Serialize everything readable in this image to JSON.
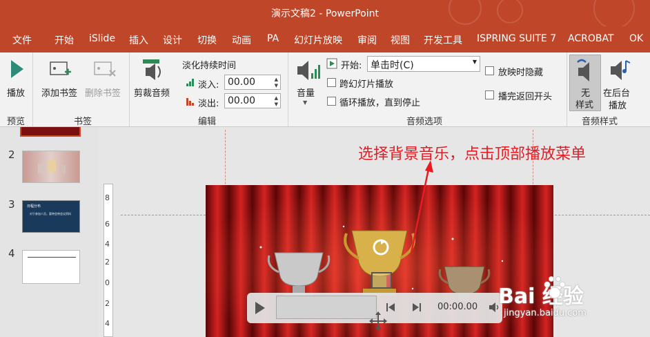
{
  "window": {
    "title": "演示文稿2 - PowerPoint"
  },
  "menu": {
    "items": [
      "文件",
      "开始",
      "iSlide",
      "插入",
      "设计",
      "切换",
      "动画",
      "PA",
      "幻灯片放映",
      "审阅",
      "视图",
      "开发工具",
      "ISPRING SUITE 7",
      "ACROBAT",
      "OK"
    ]
  },
  "ribbon": {
    "preview": {
      "play": "播放",
      "group": "预览"
    },
    "bookmarks": {
      "add": "添加书签",
      "remove": "删除书签",
      "group": "书签"
    },
    "editing": {
      "trim": "剪裁音频",
      "fade_title": "淡化持续时间",
      "fade_in_label": "淡入:",
      "fade_in_value": "00.00",
      "fade_out_label": "淡出:",
      "fade_out_value": "00.00",
      "group": "编辑"
    },
    "audio_options": {
      "volume": "音量",
      "start_label": "开始:",
      "start_value": "单击时(C)",
      "play_across": "跨幻灯片播放",
      "loop": "循环播放，直到停止",
      "hide": "放映时隐藏",
      "rewind": "播完返回开头",
      "group": "音频选项"
    },
    "audio_styles": {
      "none_l1": "无",
      "none_l2": "样式",
      "bg_l1": "在后台",
      "bg_l2": "播放",
      "group": "音频样式"
    }
  },
  "thumbnails": [
    {
      "num": "2"
    },
    {
      "num": "3",
      "text1": "日程分布",
      "text2": "对于参加人员，要带会带会议资料"
    },
    {
      "num": "4"
    }
  ],
  "annotation": "选择背景音乐，点击顶部播放菜单",
  "player": {
    "time": "00:00.00"
  },
  "watermark": {
    "logo": "Bai  经验",
    "url": "jingyan.baidu.com"
  },
  "ruler": {
    "labels": [
      "8",
      "6",
      "4",
      "2",
      "0",
      "2",
      "4"
    ]
  },
  "colors": {
    "accent": "#c0462a",
    "annotation": "#e81b23"
  }
}
